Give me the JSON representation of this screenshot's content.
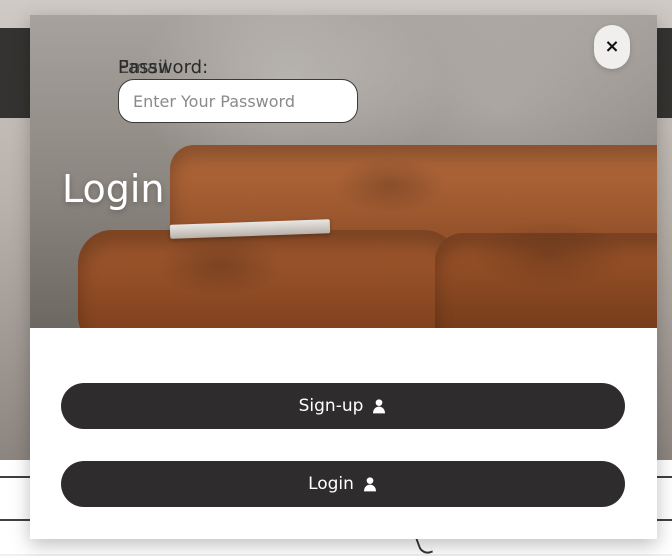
{
  "modal": {
    "hero_title": "Login",
    "labels": {
      "email": "Email",
      "password": "Password:"
    },
    "password_input": {
      "placeholder": "Enter Your Password",
      "value": ""
    },
    "close_button": {
      "label": "×"
    },
    "buttons": [
      {
        "label": "Sign-up",
        "icon": "user-icon"
      },
      {
        "label": "Login",
        "icon": "user-icon"
      }
    ]
  },
  "colors": {
    "button_bg": "#2f2c2d",
    "button_text": "#ffffff",
    "modal_bg": "#ffffff"
  }
}
